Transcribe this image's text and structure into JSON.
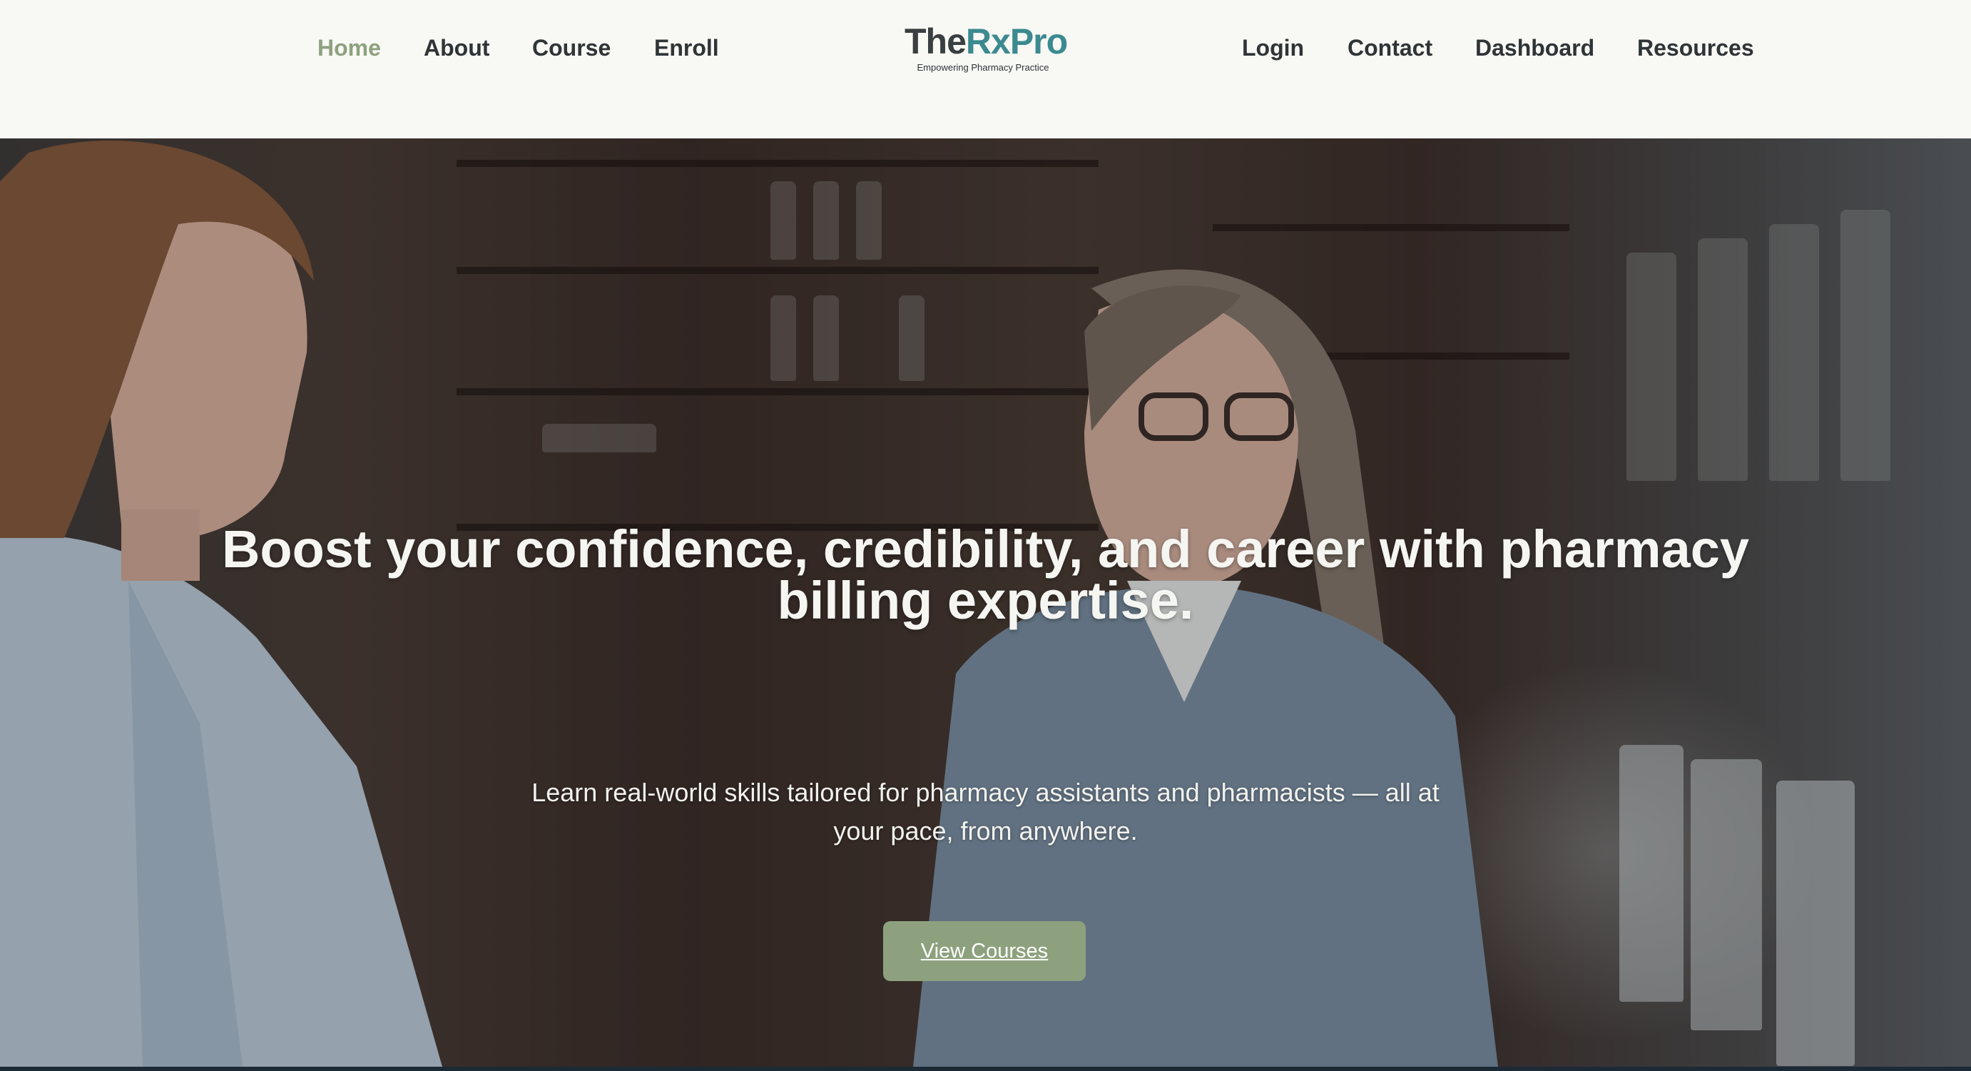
{
  "nav": {
    "left": [
      {
        "label": "Home",
        "active": true
      },
      {
        "label": "About",
        "active": false
      },
      {
        "label": "Course",
        "active": false
      },
      {
        "label": "Enroll",
        "active": false
      }
    ],
    "right": [
      {
        "label": "Login"
      },
      {
        "label": "Contact"
      },
      {
        "label": "Dashboard"
      },
      {
        "label": "Resources"
      }
    ]
  },
  "logo": {
    "part1": "The",
    "part2": "RxPro",
    "tagline": "Empowering Pharmacy Practice"
  },
  "hero": {
    "title": "Boost your confidence, credibility, and career with pharmacy billing expertise.",
    "subtitle": "Learn real-world skills tailored for pharmacy assistants and pharmacists — all at your pace, from anywhere.",
    "cta_label": "View Courses",
    "background_image": "photo of two pharmacists talking in a pharmacy with shelves of bottles"
  },
  "colors": {
    "accent": "#8da17e",
    "logo_teal": "#3c8a90",
    "header_bg": "#f8f8f4",
    "nav_text": "#2f3437"
  }
}
